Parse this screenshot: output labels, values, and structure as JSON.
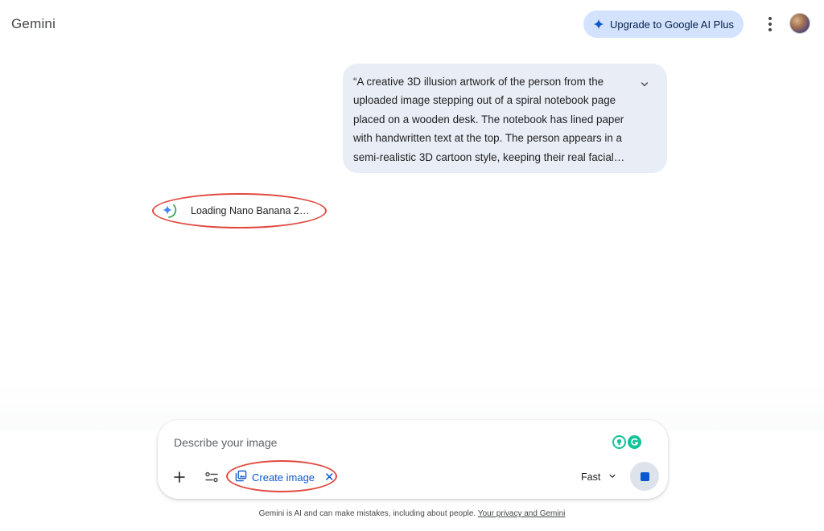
{
  "app": {
    "title": "Gemini"
  },
  "header": {
    "upgrade_label": "Upgrade to Google AI Plus",
    "upgrade_icon": "sparkle-icon",
    "menu_icon": "more-vert-icon",
    "avatar_icon": "user-avatar"
  },
  "conversation": {
    "user_message": {
      "lines": [
        "“A creative 3D illusion artwork of the person from the",
        "uploaded image stepping out of a spiral notebook page",
        "placed on a wooden desk. The notebook has lined paper",
        "with handwritten text at the top. The person appears in a",
        "semi-realistic 3D cartoon style, keeping their real facial…"
      ],
      "expand_icon": "chevron-down-icon"
    },
    "status": {
      "text": "Loading Nano Banana 2…",
      "icon": "gemini-spark-loading-icon"
    }
  },
  "composer": {
    "placeholder": "Describe your image",
    "value": "",
    "add_icon": "plus-icon",
    "tools_icon": "tools-icon",
    "tool_chip": {
      "label": "Create image",
      "icon": "image-gallery-icon",
      "close_glyph": "✕"
    },
    "mode": {
      "label": "Fast",
      "icon": "chevron-down-icon"
    },
    "stop_icon": "stop-icon",
    "extensions": [
      "grammarly-bulb-icon",
      "grammarly-icon"
    ]
  },
  "footer": {
    "text": "Gemini is AI and can make mistakes, including about people.",
    "link": "Your privacy and Gemini"
  },
  "colors": {
    "accent": "#0b57d0",
    "upgrade_bg": "#d3e3fd",
    "bubble_bg": "#e9eef6",
    "annotation": "#e0483f"
  }
}
